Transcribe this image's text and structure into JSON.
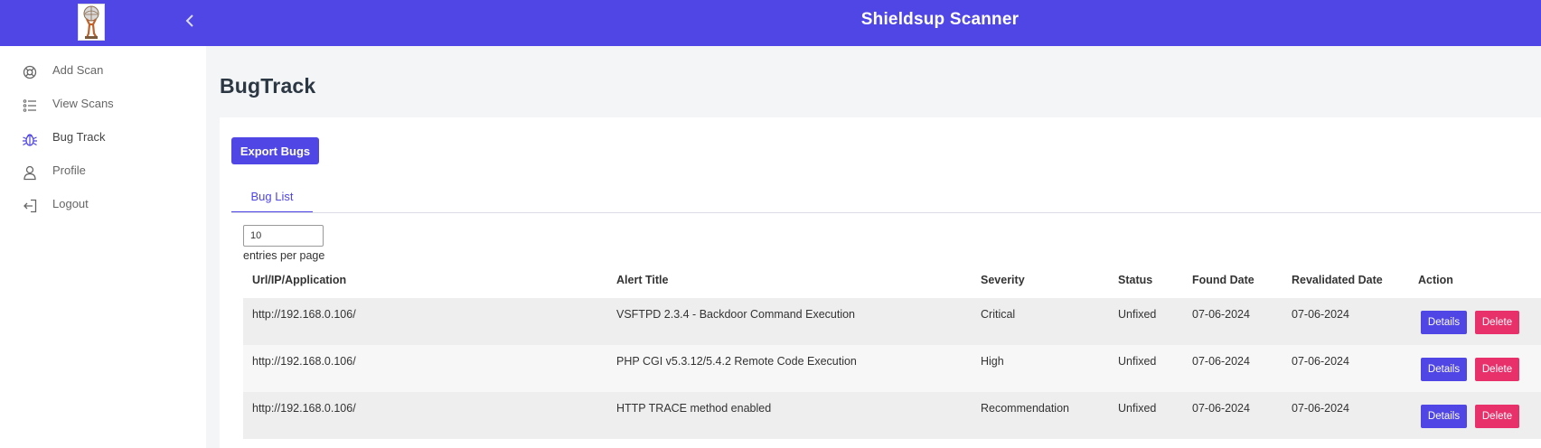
{
  "header": {
    "title": "Shieldsup Scanner",
    "collapse_icon": "chevron-left-icon",
    "logo": "atlas-logo",
    "bar_color": "#4f46e5"
  },
  "sidebar": {
    "items": [
      {
        "label": "Add Scan",
        "icon": "lifebuoy-icon"
      },
      {
        "label": "View Scans",
        "icon": "list-icon"
      },
      {
        "label": "Bug Track",
        "icon": "bug-icon",
        "active": true
      },
      {
        "label": "Profile",
        "icon": "user-icon"
      },
      {
        "label": "Logout",
        "icon": "logout-icon"
      }
    ]
  },
  "main": {
    "page_title": "BugTrack",
    "export_label": "Export Bugs",
    "tab_label": "Bug List",
    "entries_value": "10",
    "entries_label": "entries per page"
  },
  "table": {
    "columns": [
      "Url/IP/Application",
      "Alert Title",
      "Severity",
      "Status",
      "Found Date",
      "Revalidated Date",
      "Action"
    ],
    "rows": [
      {
        "url": "http://192.168.0.106/",
        "title": "VSFTPD 2.3.4 - Backdoor Command Execution",
        "severity": "Critical",
        "status": "Unfixed",
        "found": "07-06-2024",
        "revalidated": "07-06-2024",
        "details": "Details",
        "delete": "Delete"
      },
      {
        "url": "http://192.168.0.106/",
        "title": "PHP CGI v5.3.12/5.4.2 Remote Code Execution",
        "severity": "High",
        "status": "Unfixed",
        "found": "07-06-2024",
        "revalidated": "07-06-2024",
        "details": "Details",
        "delete": "Delete"
      },
      {
        "url": "http://192.168.0.106/",
        "title": "HTTP TRACE method enabled",
        "severity": "Recommendation",
        "status": "Unfixed",
        "found": "07-06-2024",
        "revalidated": "07-06-2024",
        "details": "Details",
        "delete": "Delete"
      }
    ]
  },
  "colors": {
    "accent": "#4f46e5",
    "danger": "#e8306b"
  }
}
